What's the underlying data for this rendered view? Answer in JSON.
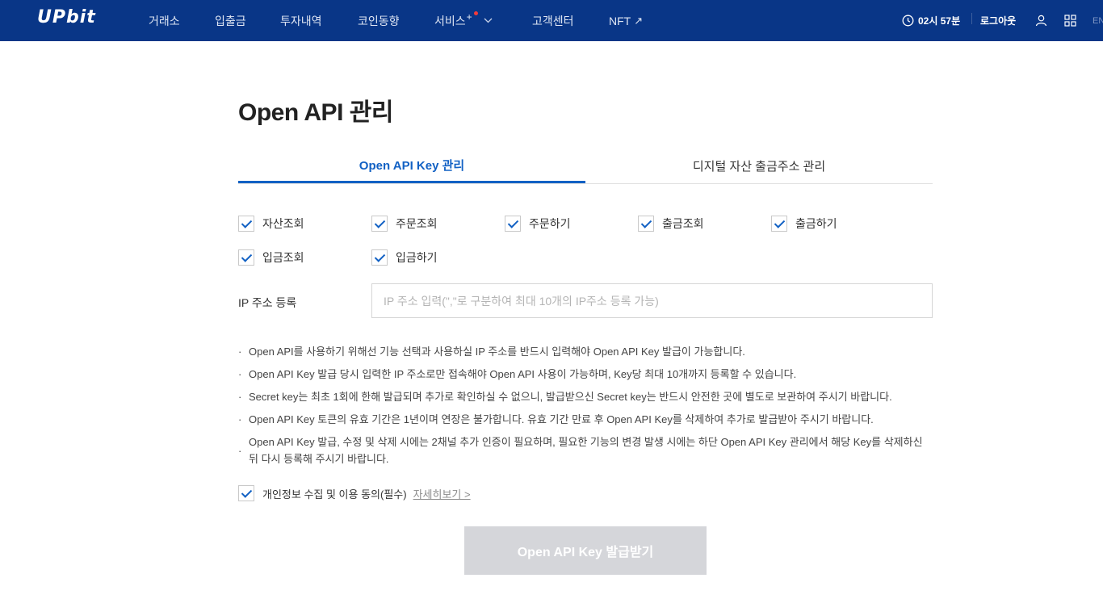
{
  "header": {
    "logo": "UPbit",
    "nav": [
      "거래소",
      "입출금",
      "투자내역",
      "코인동향",
      "서비스",
      "고객센터",
      "NFT"
    ],
    "service_sup": "+",
    "nft_arrow": "↗",
    "session_time": "02시 57분",
    "logout": "로그아웃",
    "lang": "EN"
  },
  "page": {
    "title": "Open API 관리",
    "tabs": [
      "Open API Key 관리",
      "디지털 자산 출금주소 관리"
    ],
    "permissions": [
      {
        "label": "자산조회",
        "checked": true
      },
      {
        "label": "주문조회",
        "checked": true
      },
      {
        "label": "주문하기",
        "checked": true
      },
      {
        "label": "출금조회",
        "checked": true
      },
      {
        "label": "출금하기",
        "checked": true
      },
      {
        "label": "입금조회",
        "checked": true
      },
      {
        "label": "입금하기",
        "checked": true
      }
    ],
    "ip_label": "IP 주소 등록",
    "ip_placeholder": "IP 주소 입력(\",\"로 구분하여 최대 10개의 IP주소 등록 가능)",
    "notes": [
      "Open API를 사용하기 위해선 기능 선택과 사용하실 IP 주소를 반드시 입력해야 Open API Key 발급이 가능합니다.",
      "Open API Key 발급 당시 입력한 IP 주소로만 접속해야 Open API 사용이 가능하며, Key당 최대 10개까지 등록할 수 있습니다.",
      "Secret key는 최초 1회에 한해 발급되며 추가로 확인하실 수 없으니, 발급받으신 Secret key는 반드시 안전한 곳에 별도로 보관하여 주시기 바랍니다.",
      "Open API Key 토큰의 유효 기간은 1년이며 연장은 불가합니다. 유효 기간 만료 후 Open API Key를 삭제하여 추가로 발급받아 주시기 바랍니다.",
      "Open API Key 발급, 수정 및 삭제 시에는 2채널 추가 인증이 필요하며, 필요한 기능의 변경 발생 시에는 하단 Open API Key 관리에서 해당 Key를 삭제하신 뒤 다시 등록해 주시기 바랍니다."
    ],
    "note_bullet": "·",
    "consent": {
      "label": "개인정보 수집 및 이용 동의(필수)",
      "link": "자세히보기 >",
      "checked": true
    },
    "submit": "Open API Key 발급받기"
  },
  "colors": {
    "brand": "#093687",
    "accent": "#1261c4",
    "disabled_button": "#d5d6da"
  }
}
